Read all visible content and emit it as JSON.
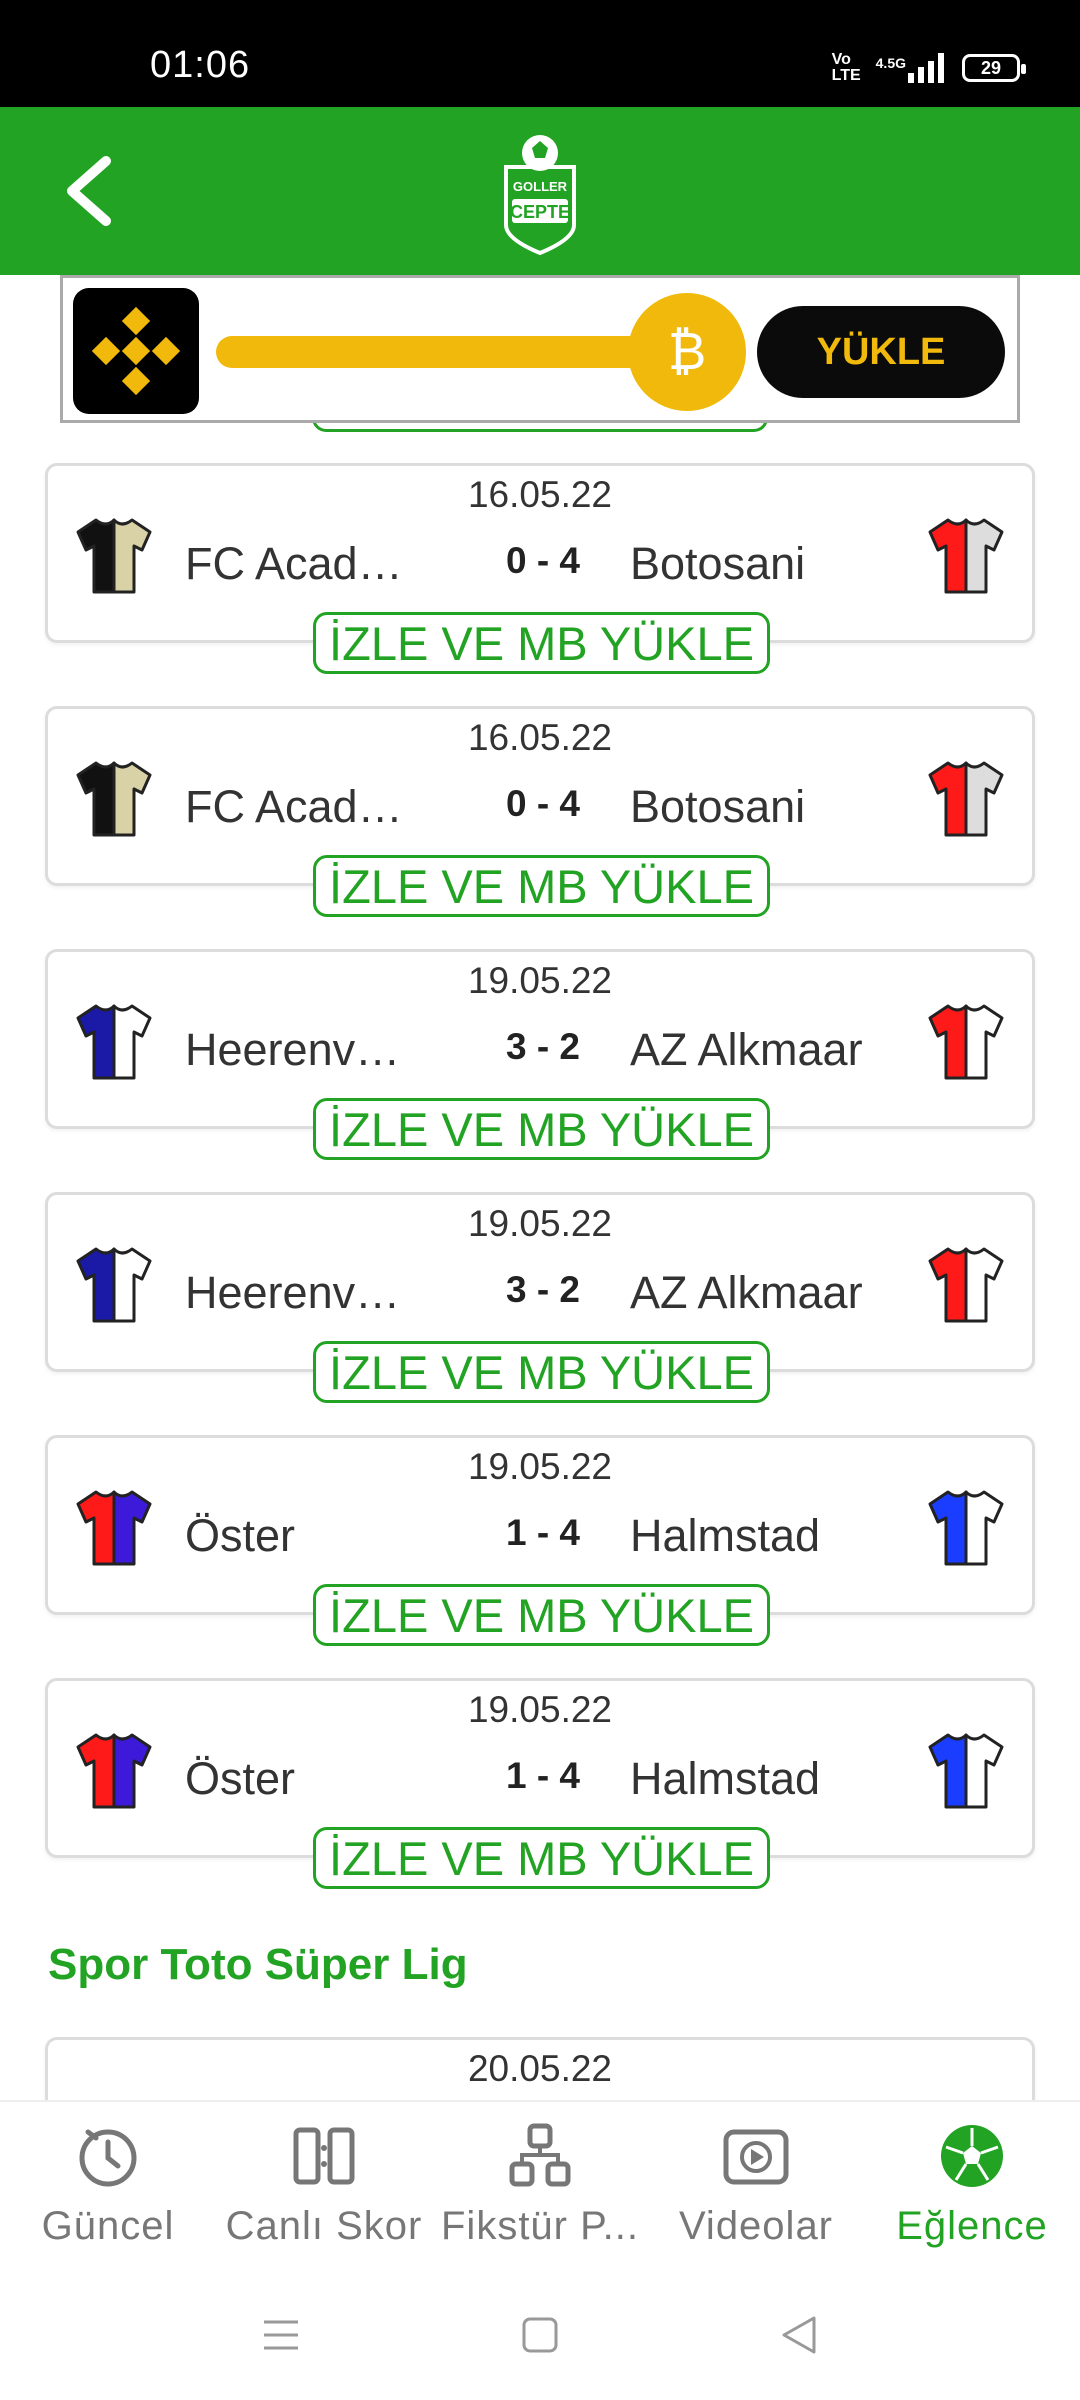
{
  "status_bar": {
    "time": "01:06",
    "volte": "Vo\nLTE",
    "network": "4.5G",
    "battery": "29"
  },
  "app_bar": {
    "logo_top": "GOLLER",
    "logo_bottom": "CEPTE"
  },
  "ad": {
    "button_label": "YÜKLE",
    "brand_color": "#f0b90b"
  },
  "matches": [
    {
      "date": "16.05.22",
      "home": "FC Academia Clinceni",
      "score": "0 - 4",
      "away": "Botosani",
      "home_colors": [
        "#111111",
        "#d9d2a6"
      ],
      "away_colors": [
        "#ff1a1a",
        "#dddddd"
      ],
      "action": "İZLE VE MB YÜKLE"
    },
    {
      "date": "16.05.22",
      "home": "FC Academia Clinceni",
      "score": "0 - 4",
      "away": "Botosani",
      "home_colors": [
        "#111111",
        "#d9d2a6"
      ],
      "away_colors": [
        "#ff1a1a",
        "#dddddd"
      ],
      "action": "İZLE VE MB YÜKLE"
    },
    {
      "date": "19.05.22",
      "home": "Heerenveen",
      "score": "3 - 2",
      "away": "AZ Alkmaar",
      "home_colors": [
        "#1a1aa6",
        "#ffffff"
      ],
      "away_colors": [
        "#ff1a1a",
        "#ffffff"
      ],
      "action": "İZLE VE MB YÜKLE"
    },
    {
      "date": "19.05.22",
      "home": "Heerenveen",
      "score": "3 - 2",
      "away": "AZ Alkmaar",
      "home_colors": [
        "#1a1aa6",
        "#ffffff"
      ],
      "away_colors": [
        "#ff1a1a",
        "#ffffff"
      ],
      "action": "İZLE VE MB YÜKLE"
    },
    {
      "date": "19.05.22",
      "home": "Öster",
      "score": "1 - 4",
      "away": "Halmstad",
      "home_colors": [
        "#ff1a1a",
        "#3d1ad9"
      ],
      "away_colors": [
        "#1a3dff",
        "#ffffff"
      ],
      "action": "İZLE VE MB YÜKLE"
    },
    {
      "date": "19.05.22",
      "home": "Öster",
      "score": "1 - 4",
      "away": "Halmstad",
      "home_colors": [
        "#ff1a1a",
        "#3d1ad9"
      ],
      "away_colors": [
        "#1a3dff",
        "#ffffff"
      ],
      "action": "İZLE VE MB YÜKLE"
    }
  ],
  "section": {
    "title": "Spor Toto Süper Lig",
    "next_date": "20.05.22"
  },
  "bottom_nav": [
    {
      "label": "Güncel",
      "icon": "clock-icon",
      "active": false
    },
    {
      "label": "Canlı Skor",
      "icon": "live-score-icon",
      "active": false
    },
    {
      "label": "Fikstür P...",
      "icon": "fixture-icon",
      "active": false
    },
    {
      "label": "Videolar",
      "icon": "video-play-icon",
      "active": false
    },
    {
      "label": "Eğlence",
      "icon": "football-icon",
      "active": true
    }
  ],
  "colors": {
    "primary_green": "#22a323",
    "status_bar": "#000000"
  }
}
